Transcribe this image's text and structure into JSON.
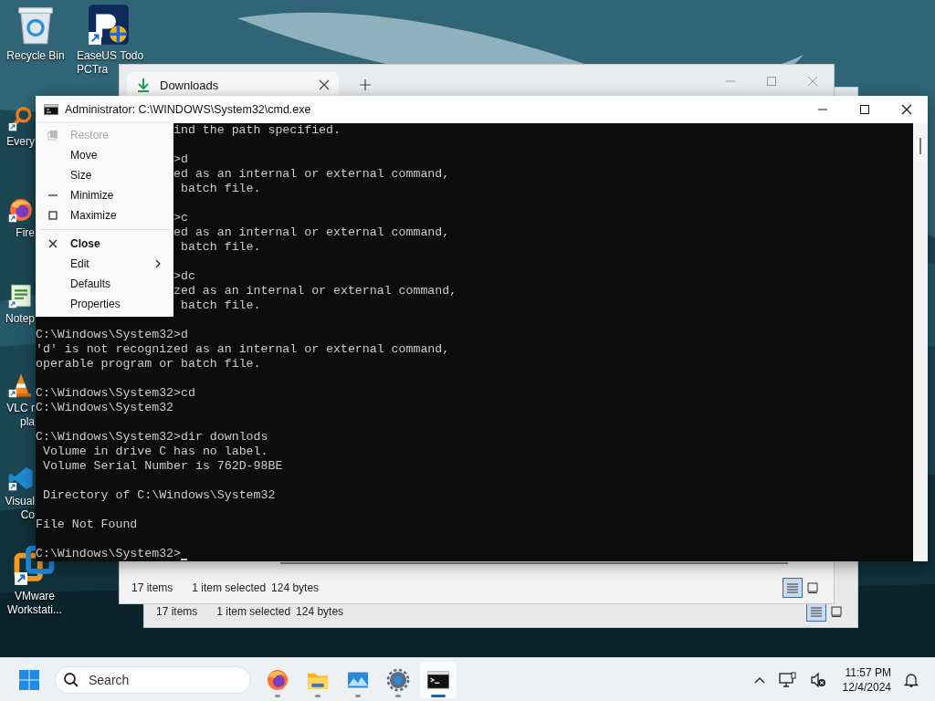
{
  "desktop_icons": [
    {
      "kind": "recycle",
      "lines": [
        "Recycle Bin"
      ],
      "shortcut": false
    },
    {
      "kind": "backup",
      "lines": [
        "EaseUS Todo",
        "PCTra"
      ],
      "shortcut": true
    },
    {
      "kind": "finder",
      "lines": [
        "Every"
      ],
      "shortcut": true
    },
    {
      "kind": "browser",
      "lines": [
        "Fire"
      ],
      "shortcut": true
    },
    {
      "kind": "notepad",
      "lines": [
        "Notep"
      ],
      "shortcut": true
    },
    {
      "kind": "media",
      "lines": [
        "VLC r",
        "pla"
      ],
      "shortcut": true
    },
    {
      "kind": "code",
      "lines": [
        "Visual",
        "Co"
      ],
      "shortcut": true
    },
    {
      "kind": "vm",
      "lines": [
        "VMware",
        "Workstati..."
      ],
      "shortcut": true
    }
  ],
  "explorer_windows": [
    {
      "tab": {
        "title": "Downloads"
      },
      "status": [
        "17 items",
        "1 item selected",
        "124 bytes"
      ],
      "views": [
        {
          "kind": "details",
          "selected": true
        },
        {
          "kind": "tiles",
          "selected": false
        }
      ]
    },
    {
      "status": [
        "17 items",
        "1 item selected",
        "124 bytes"
      ],
      "views": [
        {
          "kind": "details",
          "selected": true
        },
        {
          "kind": "tiles",
          "selected": false
        }
      ]
    }
  ],
  "cmd_window": {
    "title": "Administrator: C:\\WINDOWS\\System32\\cmd.exe",
    "console": [
      {
        "kind": "covered",
        "lines": [
          "ind the path specified."
        ]
      },
      {
        "kind": "covered",
        "lines": [
          ">d",
          "ed as an internal or external command,",
          " batch file."
        ]
      },
      {
        "kind": "covered",
        "lines": [
          ">c",
          "ed as an internal or external command,",
          " batch file."
        ]
      },
      {
        "kind": "covered",
        "lines": [
          ">dc",
          "zed as an internal or external command,",
          " batch file."
        ]
      },
      {
        "kind": "full",
        "lines": [
          "C:\\Windows\\System32>d",
          "'d' is not recognized as an internal or external command,",
          "operable program or batch file."
        ]
      },
      {
        "kind": "full",
        "lines": [
          "C:\\Windows\\System32>cd",
          "C:\\Windows\\System32"
        ]
      },
      {
        "kind": "full",
        "lines": [
          "C:\\Windows\\System32>dir downlods",
          " Volume in drive C has no label.",
          " Volume Serial Number is 762D-98BE"
        ]
      },
      {
        "kind": "full",
        "lines": [
          " Directory of C:\\Windows\\System32"
        ]
      },
      {
        "kind": "full",
        "lines": [
          "File Not Found"
        ]
      },
      {
        "kind": "prompt",
        "lines": [
          "C:\\Windows\\System32>"
        ]
      }
    ],
    "menu": [
      {
        "kind": "restore",
        "label": "Restore",
        "disabled": true,
        "bold": false,
        "separator_before": false
      },
      {
        "kind": "plain",
        "label": "Move",
        "disabled": false,
        "bold": false,
        "separator_before": false
      },
      {
        "kind": "plain",
        "label": "Size",
        "disabled": false,
        "bold": false,
        "separator_before": false
      },
      {
        "kind": "minimize",
        "label": "Minimize",
        "disabled": false,
        "bold": false,
        "separator_before": false
      },
      {
        "kind": "maximize",
        "label": "Maximize",
        "disabled": false,
        "bold": false,
        "separator_before": false
      },
      {
        "kind": "close",
        "label": "Close",
        "disabled": false,
        "bold": true,
        "separator_before": true
      },
      {
        "kind": "submenu",
        "label": "Edit",
        "disabled": false,
        "bold": false,
        "separator_before": false
      },
      {
        "kind": "plain",
        "label": "Defaults",
        "disabled": false,
        "bold": false,
        "separator_before": false
      },
      {
        "kind": "plain",
        "label": "Properties",
        "disabled": false,
        "bold": false,
        "separator_before": false
      }
    ]
  },
  "taskbar": {
    "search": {
      "placeholder": "Search"
    },
    "apps": [
      {
        "kind": "browser",
        "selected": false
      },
      {
        "kind": "folder",
        "selected": false
      },
      {
        "kind": "photos",
        "selected": false
      },
      {
        "kind": "settings",
        "selected": false
      },
      {
        "kind": "terminal",
        "selected": true
      }
    ],
    "clock": {
      "time": "11:57 PM",
      "date": "12/4/2024"
    }
  }
}
